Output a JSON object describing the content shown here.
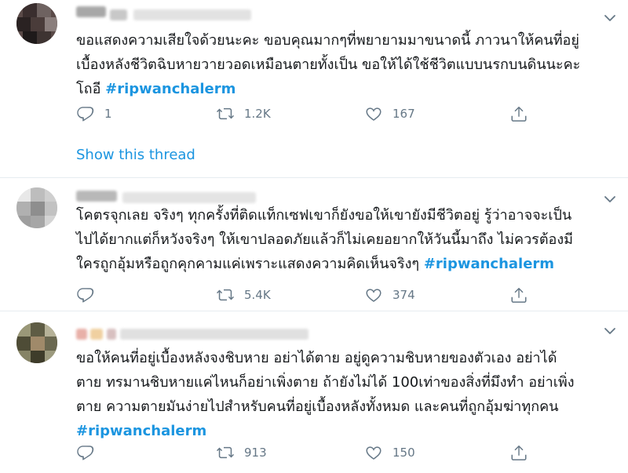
{
  "tweets": [
    {
      "lines": [
        "ขอแสดงความเสียใจด้วยนะคะ ขอบคุณมากๆที่พยายามมาขนาดนี้ ภาวนาให้คนที่อยู่",
        "เบื้องหลังชีวิตฉิบหายวายวอดเหมือนตายทั้งเป็น ขอให้ได้ใช้ชีวิตแบบนรกบนดินนะคะ",
        "โถอี "
      ],
      "hashtag": "#ripwanchalerm",
      "reply_count": "1",
      "retweet_count": "1.2K",
      "like_count": "167",
      "show_thread": "Show this thread"
    },
    {
      "lines": [
        "โคตรจุกเลย จริงๆ ทุกครั้งที่ติดแท็กเซฟเขาก็ยังขอให้เขายังมีชีวิตอยู่ รู้ว่าอาจจะเป็น",
        "ไปได้ยากแต่ก็หวังจริงๆ ให้เขาปลอดภัยแล้วก็ไม่เคยอยากให้วันนี้มาถึง ไม่ควรต้องมี",
        "ใครถูกอุ้มหรือถูกคุกคามแค่เพราะแสดงความคิดเห็นจริงๆ "
      ],
      "hashtag": "#ripwanchalerm",
      "reply_count": "",
      "retweet_count": "5.4K",
      "like_count": "374"
    },
    {
      "lines": [
        "ขอให้คนที่อยู่เบื้องหลังจงชิบหาย อย่าได้ตาย อยู่ดูความชิบหายของตัวเอง อย่าได้",
        "ตาย ทรมานชิบหายแค่ไหนก็อย่าเพิ่งตาย ถ้ายังไม่ได้ 100เท่าของสิ่งที่มึงทำ อย่าเพิ่ง",
        "ตาย ความตายมันง่ายไปสำหรับคนที่อยู่เบื้องหลังทั้งหมด และคนที่ถูกอุ้มฆ่าทุกคน",
        ""
      ],
      "hashtag": "#ripwanchalerm",
      "reply_count": "",
      "retweet_count": "913",
      "like_count": "150"
    }
  ],
  "icons": {
    "reply": "reply-icon",
    "retweet": "retweet-icon",
    "like": "heart-icon",
    "share": "share-icon",
    "caret": "chevron-down-icon"
  },
  "colors": {
    "accent": "#1b95e0",
    "muted": "#657786",
    "divider": "#e6ecf0"
  }
}
